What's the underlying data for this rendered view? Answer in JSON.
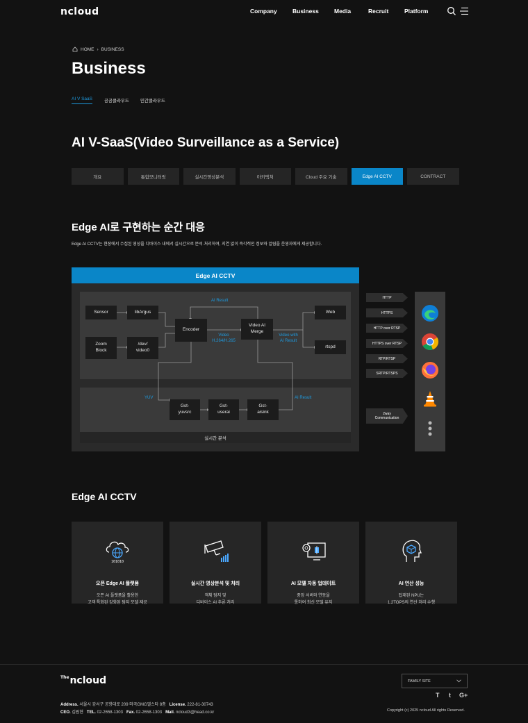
{
  "header": {
    "logo": "ncloud",
    "nav": [
      "Company",
      "Business",
      "Media",
      "Recruit",
      "Platform"
    ]
  },
  "breadcrumb": {
    "home": "HOME",
    "current": "BUSINESS"
  },
  "page_title": "Business",
  "subtabs": [
    "AI V SaaS",
    "공공클라우드",
    "민간클라우드"
  ],
  "section_title": "AI V-SaaS(Video Surveillance as a Service)",
  "tabs": [
    "개요",
    "통합모니터링",
    "실시간영상분석",
    "아키텍처",
    "Cloud 주요 기술",
    "Edge AI CCTV",
    "CONTRACT"
  ],
  "active_tab": "Edge AI CCTV",
  "edge": {
    "title": "Edge AI로 구현하는 순간 대응",
    "description": "Edge AI CCTV는 현장에서 수집된 영상을 디바이스 내에서 실시간으로 분석·처리하여, 지연 없이 즉각적인 정보와 알림을 운영자에게 제공합니다."
  },
  "diagram": {
    "title": "Edge AI  CCTV",
    "blocks": {
      "sensor": "Sensor",
      "libargus": "libArgus",
      "zoom1": "Zoom",
      "zoom2": "Block",
      "dev1": "/dev/",
      "dev2": "video0",
      "encoder": "Encoder",
      "merge1": "Video AI",
      "merge2": "Merge",
      "web": "Web",
      "rtspd": "rtspd",
      "yuv1": "Gst-",
      "yuv2": "yuvsrc",
      "userai1": "Gst-",
      "userai2": "userai",
      "aisink1": "Gst-",
      "aisink2": "aisink"
    },
    "labels": {
      "ai_result_top": "AI Result",
      "video1": "Video",
      "video2": "H.264/H.265",
      "video_with1": "Video with",
      "video_with2": "AI Result",
      "yuv": "YUV",
      "ai_result_bottom": "AI Result",
      "zone2": "실시간 분석"
    },
    "protocols": [
      "HTTP",
      "HTTPS",
      "HTTP over RTSP",
      "HTTPS over RTSP",
      "RTP/RTSP",
      "SRTP/RTSPS"
    ],
    "twoway1": "2way",
    "twoway2": "Communication"
  },
  "features": {
    "title": "Edge AI  CCTV",
    "cards": [
      {
        "icon": "cloud-globe-icon",
        "title": "오픈 Edge AI 플랫폼",
        "line1": "오픈 AI 플랫폼을 활용한",
        "line2": "고객 특화된 강화된 탐지 모델 제공"
      },
      {
        "icon": "cctv-camera-icon",
        "title": "실시간 영상분석 및 처리",
        "line1": "객체 탐지 및",
        "line2": "디바이스 AI 추론 처리"
      },
      {
        "icon": "gear-monitor-icon",
        "title": "AI 모델 자동 업데이트",
        "line1": "중앙 서버와 연동을",
        "line2": "통하여 최신 모델 유지"
      },
      {
        "icon": "ai-head-icon",
        "title": "AI 연산 성능",
        "line1": "탑재된 NPU는",
        "line2": "1.2TOPS의 연산 처리 수행"
      }
    ]
  },
  "footer": {
    "logo_the": "The",
    "logo": "ncloud",
    "address_label": "Address.",
    "address": "서울시 강서구 공항대로 209 마곡GMG엘스타 8층",
    "license_label": "License.",
    "license": "222-81-30743",
    "ceo_label": "CEO.",
    "ceo": "김원현",
    "tel_label": "TEL.",
    "tel": "02-2658-1303",
    "fax_label": "Fax.",
    "fax": "02-2658-1303",
    "mail_label": "Mail.",
    "mail": "ncloud3@head.co.kr",
    "family_site": "FAMILY SITE",
    "social": [
      "T",
      "t",
      "G+"
    ],
    "copyright": "Copyright (c) 2025 ncloud All rights Reserved."
  },
  "colors": {
    "accent": "#0a86c8",
    "bg": "#121212",
    "card": "#262626"
  }
}
